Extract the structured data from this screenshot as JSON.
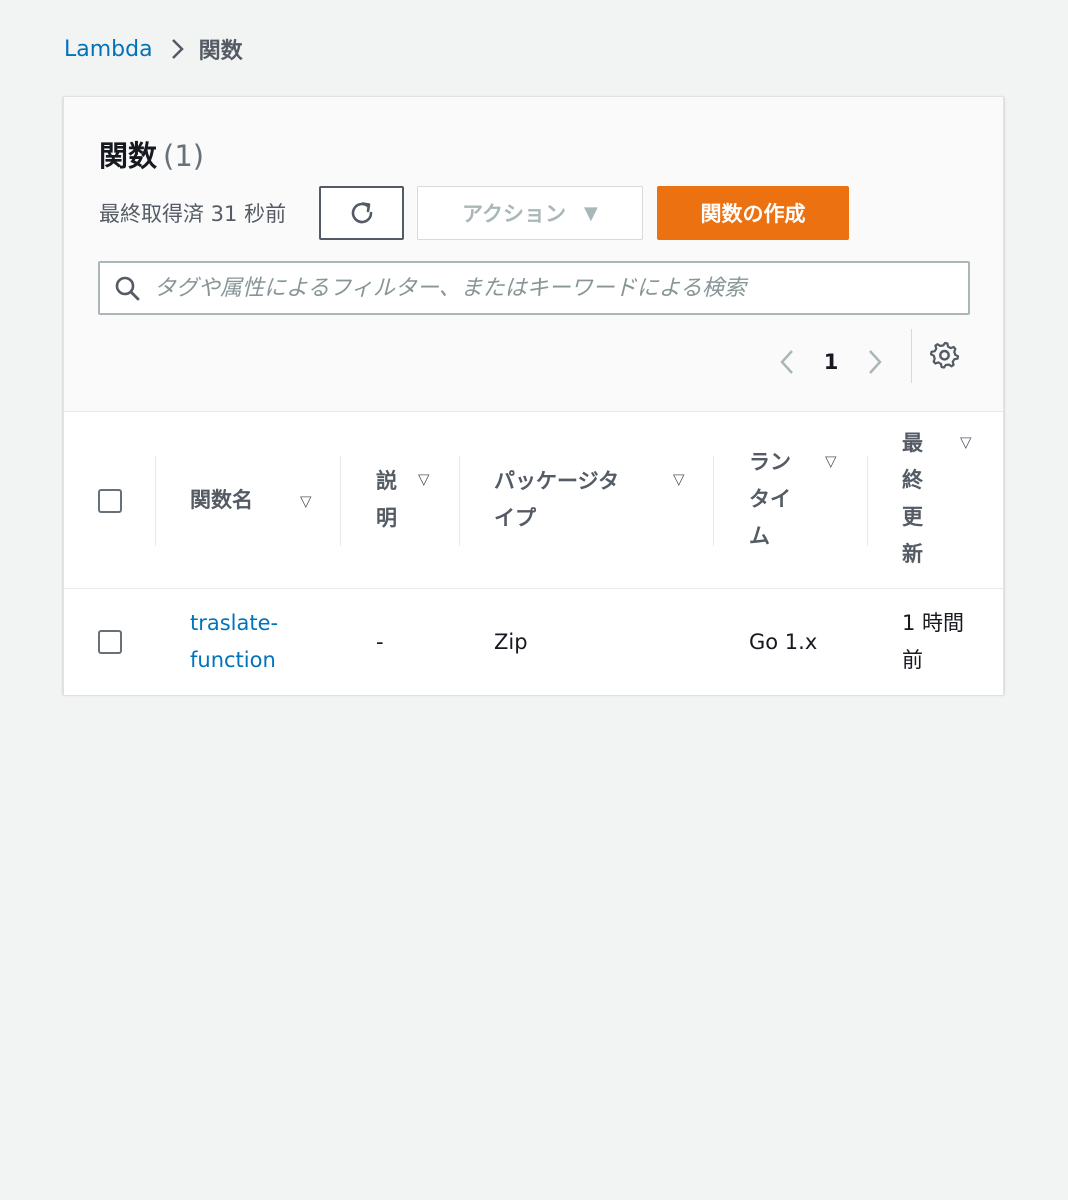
{
  "breadcrumb": {
    "root": "Lambda",
    "current": "関数"
  },
  "panel": {
    "title": "関数",
    "count": "(1)",
    "last_fetched": "最終取得済 31 秒前",
    "action_label": "アクション",
    "create_label": "関数の作成",
    "search_placeholder": "タグや属性によるフィルター、またはキーワードによる検索",
    "page_number": "1"
  },
  "table": {
    "headers": [
      {
        "key": "name",
        "lines": [
          "関数名"
        ]
      },
      {
        "key": "description",
        "lines": [
          "説",
          "明"
        ]
      },
      {
        "key": "package_type",
        "lines": [
          "パッケージタ",
          "イプ"
        ]
      },
      {
        "key": "runtime",
        "lines": [
          "ラン",
          "タイ",
          "ム"
        ]
      },
      {
        "key": "last_modified",
        "lines": [
          "最",
          "終",
          "更",
          "新"
        ]
      }
    ],
    "rows": [
      {
        "name_lines": [
          "traslate-",
          "function"
        ],
        "description": "-",
        "package_type": "Zip",
        "runtime": "Go 1.x",
        "last_modified_lines": [
          "1 時間",
          "前"
        ]
      }
    ]
  },
  "colors": {
    "link": "#0073bb",
    "primary": "#ec7211",
    "bg": "#f2f3f3"
  }
}
